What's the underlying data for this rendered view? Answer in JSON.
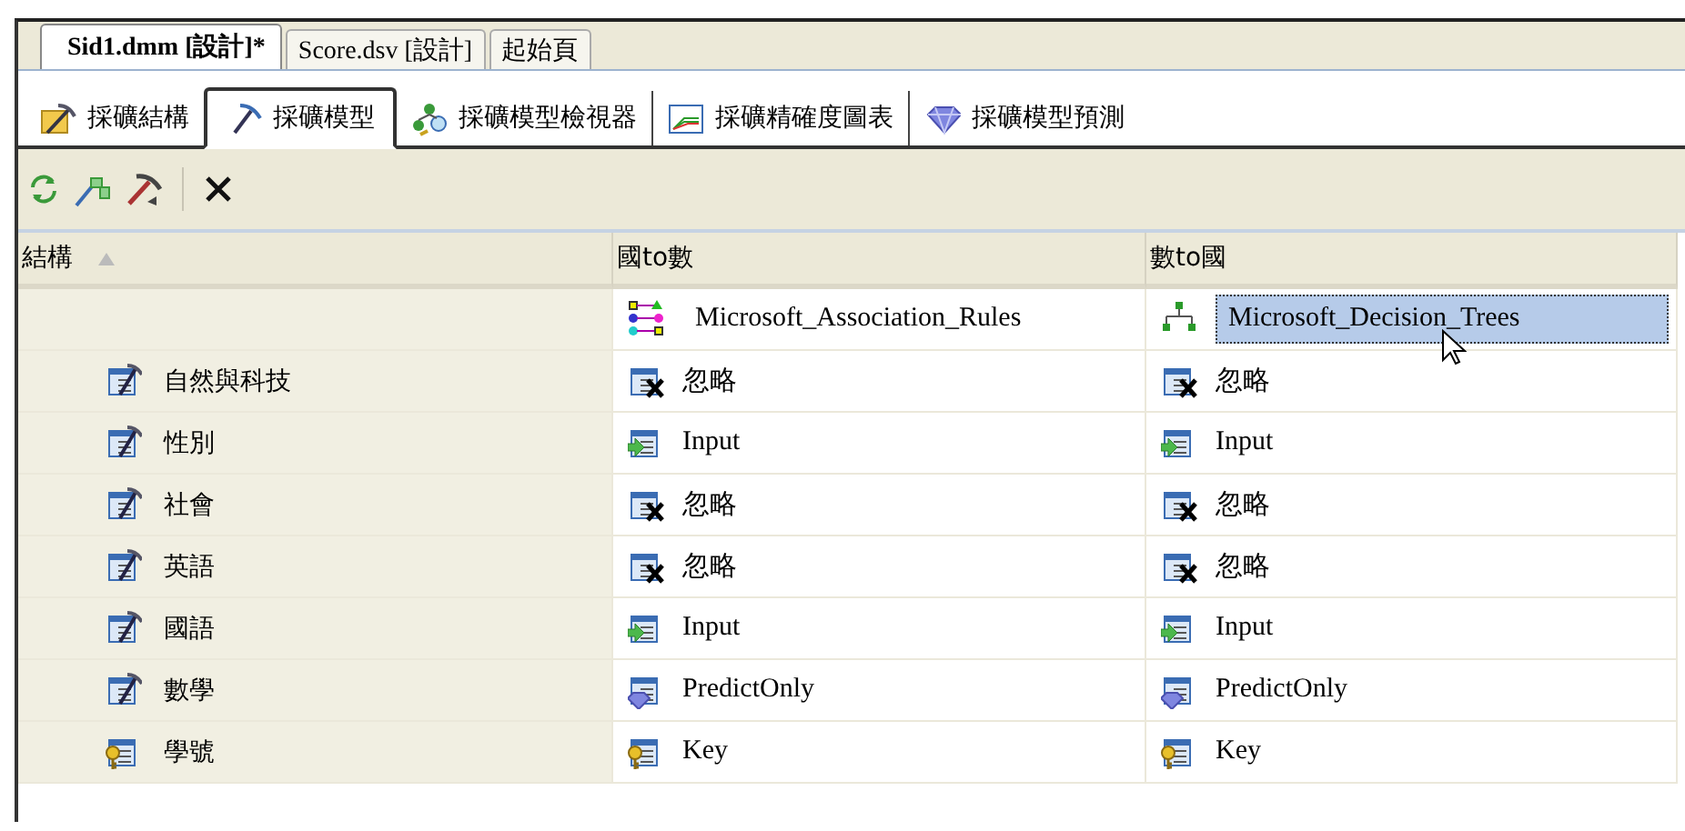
{
  "document_tabs": [
    {
      "label": "Sid1.dmm [設計]*",
      "selected": true
    },
    {
      "label": "Score.dsv [設計]",
      "selected": false
    },
    {
      "label": "起始頁",
      "selected": false
    }
  ],
  "designer_tabs": [
    {
      "label": "採礦結構",
      "kind": "structure",
      "selected": false
    },
    {
      "label": "採礦模型",
      "kind": "model",
      "selected": true
    },
    {
      "label": "採礦模型檢視器",
      "kind": "viewer",
      "selected": false
    },
    {
      "label": "採礦精確度圖表",
      "kind": "chart",
      "selected": false
    },
    {
      "label": "採礦模型預測",
      "kind": "prediction",
      "selected": false
    }
  ],
  "grid": {
    "columns": [
      {
        "label": "結構",
        "sorted": true
      },
      {
        "label": "國to數",
        "sorted": false
      },
      {
        "label": "數to國",
        "sorted": false
      }
    ],
    "models": [
      {
        "algorithm": "Microsoft_Association_Rules",
        "kind": "association",
        "selected": false
      },
      {
        "algorithm": "Microsoft_Decision_Trees",
        "kind": "tree",
        "selected": true
      }
    ],
    "rows": [
      {
        "name": "自然與科技",
        "kind": "column",
        "usages": [
          {
            "label": "忽略",
            "kind": "ignore"
          },
          {
            "label": "忽略",
            "kind": "ignore"
          }
        ]
      },
      {
        "name": "性別",
        "kind": "column",
        "usages": [
          {
            "label": "Input",
            "kind": "input"
          },
          {
            "label": "Input",
            "kind": "input"
          }
        ]
      },
      {
        "name": "社會",
        "kind": "column",
        "usages": [
          {
            "label": "忽略",
            "kind": "ignore"
          },
          {
            "label": "忽略",
            "kind": "ignore"
          }
        ]
      },
      {
        "name": "英語",
        "kind": "column",
        "usages": [
          {
            "label": "忽略",
            "kind": "ignore"
          },
          {
            "label": "忽略",
            "kind": "ignore"
          }
        ]
      },
      {
        "name": "國語",
        "kind": "column",
        "usages": [
          {
            "label": "Input",
            "kind": "input"
          },
          {
            "label": "Input",
            "kind": "input"
          }
        ]
      },
      {
        "name": "數學",
        "kind": "column",
        "usages": [
          {
            "label": "PredictOnly",
            "kind": "predict"
          },
          {
            "label": "PredictOnly",
            "kind": "predict"
          }
        ]
      },
      {
        "name": "學號",
        "kind": "key",
        "usages": [
          {
            "label": "Key",
            "kind": "key"
          },
          {
            "label": "Key",
            "kind": "key"
          }
        ]
      }
    ]
  }
}
